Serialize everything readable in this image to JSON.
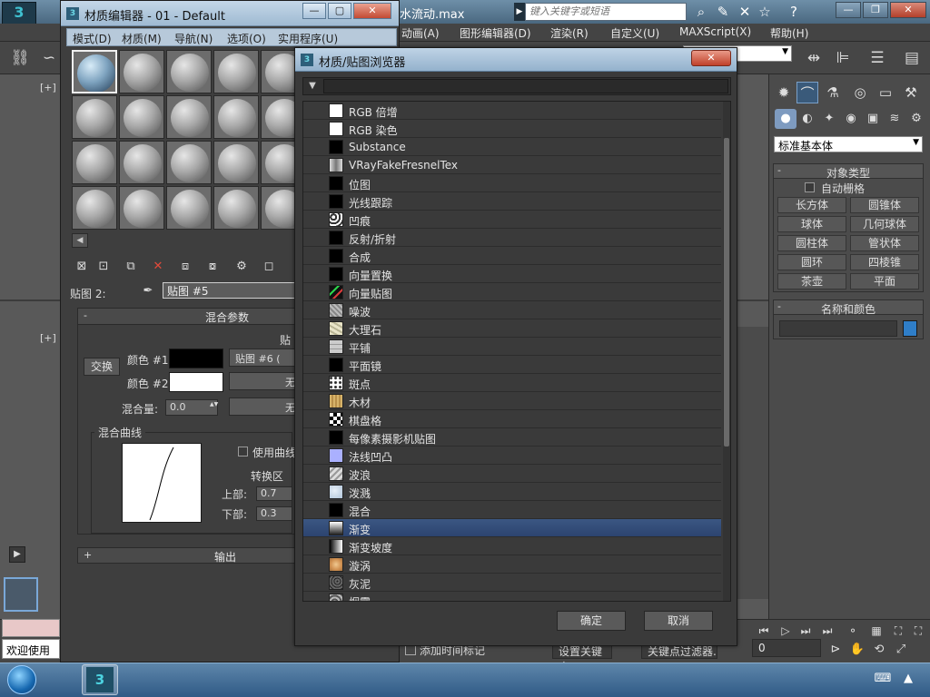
{
  "app": {
    "title_fragment": "水流动.max",
    "search_placeholder": "键入关键字或短语",
    "menu": [
      "动画(A)",
      "图形编辑器(D)",
      "渲染(R)",
      "自定义(U)",
      "MAXScript(X)",
      "帮助(H)"
    ],
    "viewport_labels": [
      "[+]",
      "[+]"
    ]
  },
  "command_panel": {
    "dropdown_value": "标准基本体",
    "object_type": {
      "title": "对象类型",
      "auto_grid": "自动栅格",
      "buttons": [
        "长方体",
        "圆锥体",
        "球体",
        "几何球体",
        "圆柱体",
        "管状体",
        "圆环",
        "四棱锥",
        "茶壶",
        "平面"
      ]
    },
    "name_color": {
      "title": "名称和颜色",
      "swatch_color": "#2f7ec8"
    }
  },
  "status": {
    "welcome": "欢迎使用",
    "add_time_tag": "添加时间标记",
    "set_key": "设置关键点",
    "key_filters": "关键点过滤器...",
    "frame_value": "0"
  },
  "material_editor": {
    "title": "材质编辑器 - 01 - Default",
    "menu": [
      "模式(D)",
      "材质(M)",
      "导航(N)",
      "选项(O)",
      "实用程序(U)"
    ],
    "map_label": "贴图 2:",
    "map_name": "贴图 #5",
    "blend_params": {
      "title": "混合参数",
      "swap": "交换",
      "color1_label": "颜色 #1",
      "color2_label": "颜色 #2",
      "color1": "#000000",
      "color2": "#ffffff",
      "color1_map": "贴图 #6 (",
      "color2_map": "无",
      "maps_header": "贴",
      "mix_amount_label": "混合量:",
      "mix_amount": "0.0",
      "mix_map": "无",
      "curve_group": "混合曲线",
      "use_curve": "使用曲线",
      "transition_zone": "转换区",
      "upper_label": "上部:",
      "upper_value": "0.7",
      "lower_label": "下部:",
      "lower_value": "0.3"
    },
    "output": {
      "title": "输出"
    }
  },
  "browser": {
    "title": "材质/贴图浏览器",
    "items": [
      {
        "name": "RGB 倍增",
        "thumb": "t-white"
      },
      {
        "name": "RGB 染色",
        "thumb": "t-white"
      },
      {
        "name": "Substance",
        "thumb": "t-black"
      },
      {
        "name": "VRayFakeFresnelTex",
        "thumb": "t-fresnel"
      },
      {
        "name": "位图",
        "thumb": "t-black"
      },
      {
        "name": "光线跟踪",
        "thumb": "t-black"
      },
      {
        "name": "凹痕",
        "thumb": "t-dent"
      },
      {
        "name": "反射/折射",
        "thumb": "t-black"
      },
      {
        "name": "合成",
        "thumb": "t-black"
      },
      {
        "name": "向量置换",
        "thumb": "t-black"
      },
      {
        "name": "向量贴图",
        "thumb": "t-vecmap"
      },
      {
        "name": "噪波",
        "thumb": "t-noise"
      },
      {
        "name": "大理石",
        "thumb": "t-marble"
      },
      {
        "name": "平铺",
        "thumb": "t-tile"
      },
      {
        "name": "平面镜",
        "thumb": "t-black"
      },
      {
        "name": "斑点",
        "thumb": "t-speckle"
      },
      {
        "name": "木材",
        "thumb": "t-wood"
      },
      {
        "name": "棋盘格",
        "thumb": "t-checker"
      },
      {
        "name": "每像素摄影机贴图",
        "thumb": "t-black"
      },
      {
        "name": "法线凹凸",
        "thumb": "t-normal"
      },
      {
        "name": "波浪",
        "thumb": "t-wave"
      },
      {
        "name": "泼溅",
        "thumb": "t-splash"
      },
      {
        "name": "混合",
        "thumb": "t-black"
      },
      {
        "name": "渐变",
        "thumb": "t-gradient"
      },
      {
        "name": "渐变坡度",
        "thumb": "t-gradramp"
      },
      {
        "name": "漩涡",
        "thumb": "t-swirl"
      },
      {
        "name": "灰泥",
        "thumb": "t-stucco"
      },
      {
        "name": "烟雾",
        "thumb": "t-smoke"
      }
    ],
    "selected_item": "渐变",
    "ok": "确定",
    "cancel": "取消"
  }
}
